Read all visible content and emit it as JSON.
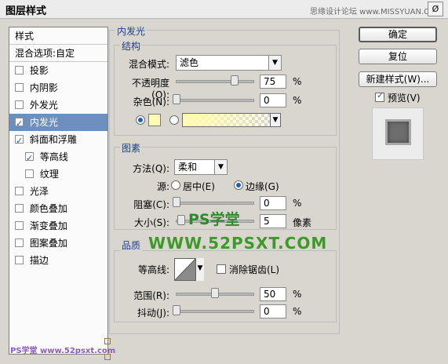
{
  "window": {
    "title": "图层样式",
    "top_watermark": "思缘设计论坛 www.MISSYUAN.COM",
    "close_glyph": "Ø"
  },
  "left_panel": {
    "items": [
      {
        "label": "样式",
        "has_checkbox": false,
        "checked": false,
        "active": false
      },
      {
        "label": "混合选项:自定",
        "has_checkbox": false,
        "checked": false,
        "active": false
      },
      {
        "label": "投影",
        "has_checkbox": true,
        "checked": false,
        "active": false
      },
      {
        "label": "内阴影",
        "has_checkbox": true,
        "checked": false,
        "active": false
      },
      {
        "label": "外发光",
        "has_checkbox": true,
        "checked": false,
        "active": false
      },
      {
        "label": "内发光",
        "has_checkbox": true,
        "checked": true,
        "active": true
      },
      {
        "label": "斜面和浮雕",
        "has_checkbox": true,
        "checked": true,
        "active": false
      },
      {
        "label": "等高线",
        "has_checkbox": true,
        "checked": true,
        "active": false
      },
      {
        "label": "纹理",
        "has_checkbox": true,
        "checked": false,
        "active": false
      },
      {
        "label": "光泽",
        "has_checkbox": true,
        "checked": false,
        "active": false
      },
      {
        "label": "颜色叠加",
        "has_checkbox": true,
        "checked": false,
        "active": false
      },
      {
        "label": "渐变叠加",
        "has_checkbox": true,
        "checked": false,
        "active": false
      },
      {
        "label": "图案叠加",
        "has_checkbox": true,
        "checked": false,
        "active": false
      },
      {
        "label": "描边",
        "has_checkbox": true,
        "checked": false,
        "active": false
      }
    ]
  },
  "inner_glow": {
    "section_title": "内发光",
    "structure": {
      "title": "结构",
      "blend_mode_label": "混合模式:",
      "blend_mode_value": "滤色",
      "opacity_label": "不透明度(O):",
      "opacity_value": "75",
      "opacity_unit": "%",
      "noise_label": "杂色(N):",
      "noise_value": "0",
      "noise_unit": "%",
      "swatch_color": "#fffbb3"
    },
    "elements": {
      "title": "图素",
      "method_label": "方法(Q):",
      "method_value": "柔和",
      "source_label": "源:",
      "source_center_label": "居中(E)",
      "source_edge_label": "边缘(G)",
      "choke_label": "阻塞(C):",
      "choke_value": "0",
      "choke_unit": "%",
      "size_label": "大小(S):",
      "size_value": "5",
      "size_unit": "像素"
    },
    "quality": {
      "title": "品质",
      "contour_label": "等高线:",
      "anti_alias_label": "消除锯齿(L)",
      "range_label": "范围(R):",
      "range_value": "50",
      "range_unit": "%",
      "jitter_label": "抖动(J):",
      "jitter_value": "0",
      "jitter_unit": "%"
    }
  },
  "buttons": {
    "ok": "确定",
    "reset": "复位",
    "new_style": "新建样式(W)...",
    "preview_label": "预览(V)"
  },
  "watermarks": {
    "ps_study": "PS学堂",
    "site": "WWW.52PSXT.COM",
    "footer": "PS学堂 www.52psxt.com"
  }
}
